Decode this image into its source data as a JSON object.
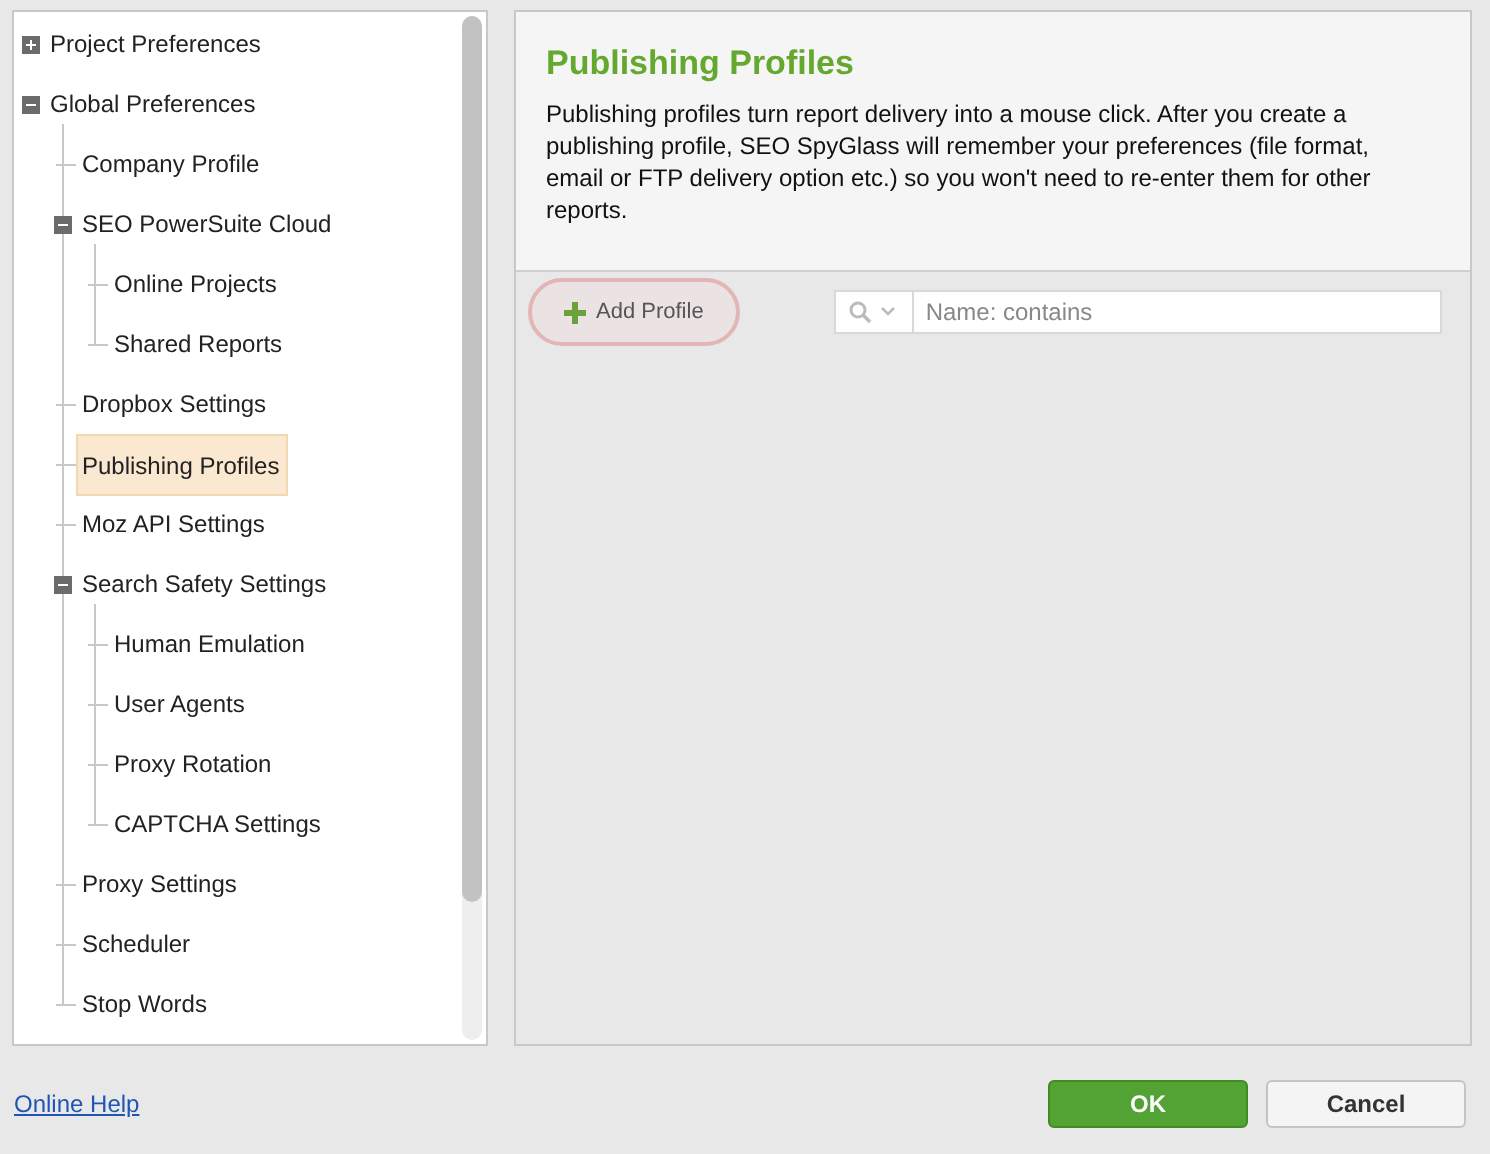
{
  "tree": {
    "items": [
      {
        "label": "Project Preferences",
        "expanded": false,
        "selected": false
      },
      {
        "label": "Global Preferences",
        "expanded": true,
        "selected": false,
        "children": [
          {
            "label": "Company Profile",
            "selected": false
          },
          {
            "label": "SEO PowerSuite Cloud",
            "expanded": true,
            "selected": false,
            "children": [
              {
                "label": "Online Projects",
                "selected": false
              },
              {
                "label": "Shared Reports",
                "selected": false
              }
            ]
          },
          {
            "label": "Dropbox Settings",
            "selected": false
          },
          {
            "label": "Publishing Profiles",
            "selected": true
          },
          {
            "label": "Moz API Settings",
            "selected": false
          },
          {
            "label": "Search Safety Settings",
            "expanded": true,
            "selected": false,
            "children": [
              {
                "label": "Human Emulation",
                "selected": false
              },
              {
                "label": "User Agents",
                "selected": false
              },
              {
                "label": "Proxy Rotation",
                "selected": false
              },
              {
                "label": "CAPTCHA Settings",
                "selected": false
              }
            ]
          },
          {
            "label": "Proxy Settings",
            "selected": false
          },
          {
            "label": "Scheduler",
            "selected": false
          },
          {
            "label": "Stop Words",
            "selected": false
          }
        ]
      }
    ]
  },
  "panel": {
    "title": "Publishing Profiles",
    "description": "Publishing profiles turn report delivery into a mouse click. After you create a publishing profile, SEO SpyGlass will remember your preferences (file format, email or FTP delivery option etc.) so you won't need to re-enter them for other reports.",
    "add_button": "Add Profile",
    "filter": {
      "placeholder": "Name: contains"
    }
  },
  "footer": {
    "help_link": "Online Help",
    "buttons": [
      {
        "label": "OK",
        "kind": "primary"
      },
      {
        "label": "Cancel",
        "kind": "secondary"
      }
    ]
  }
}
